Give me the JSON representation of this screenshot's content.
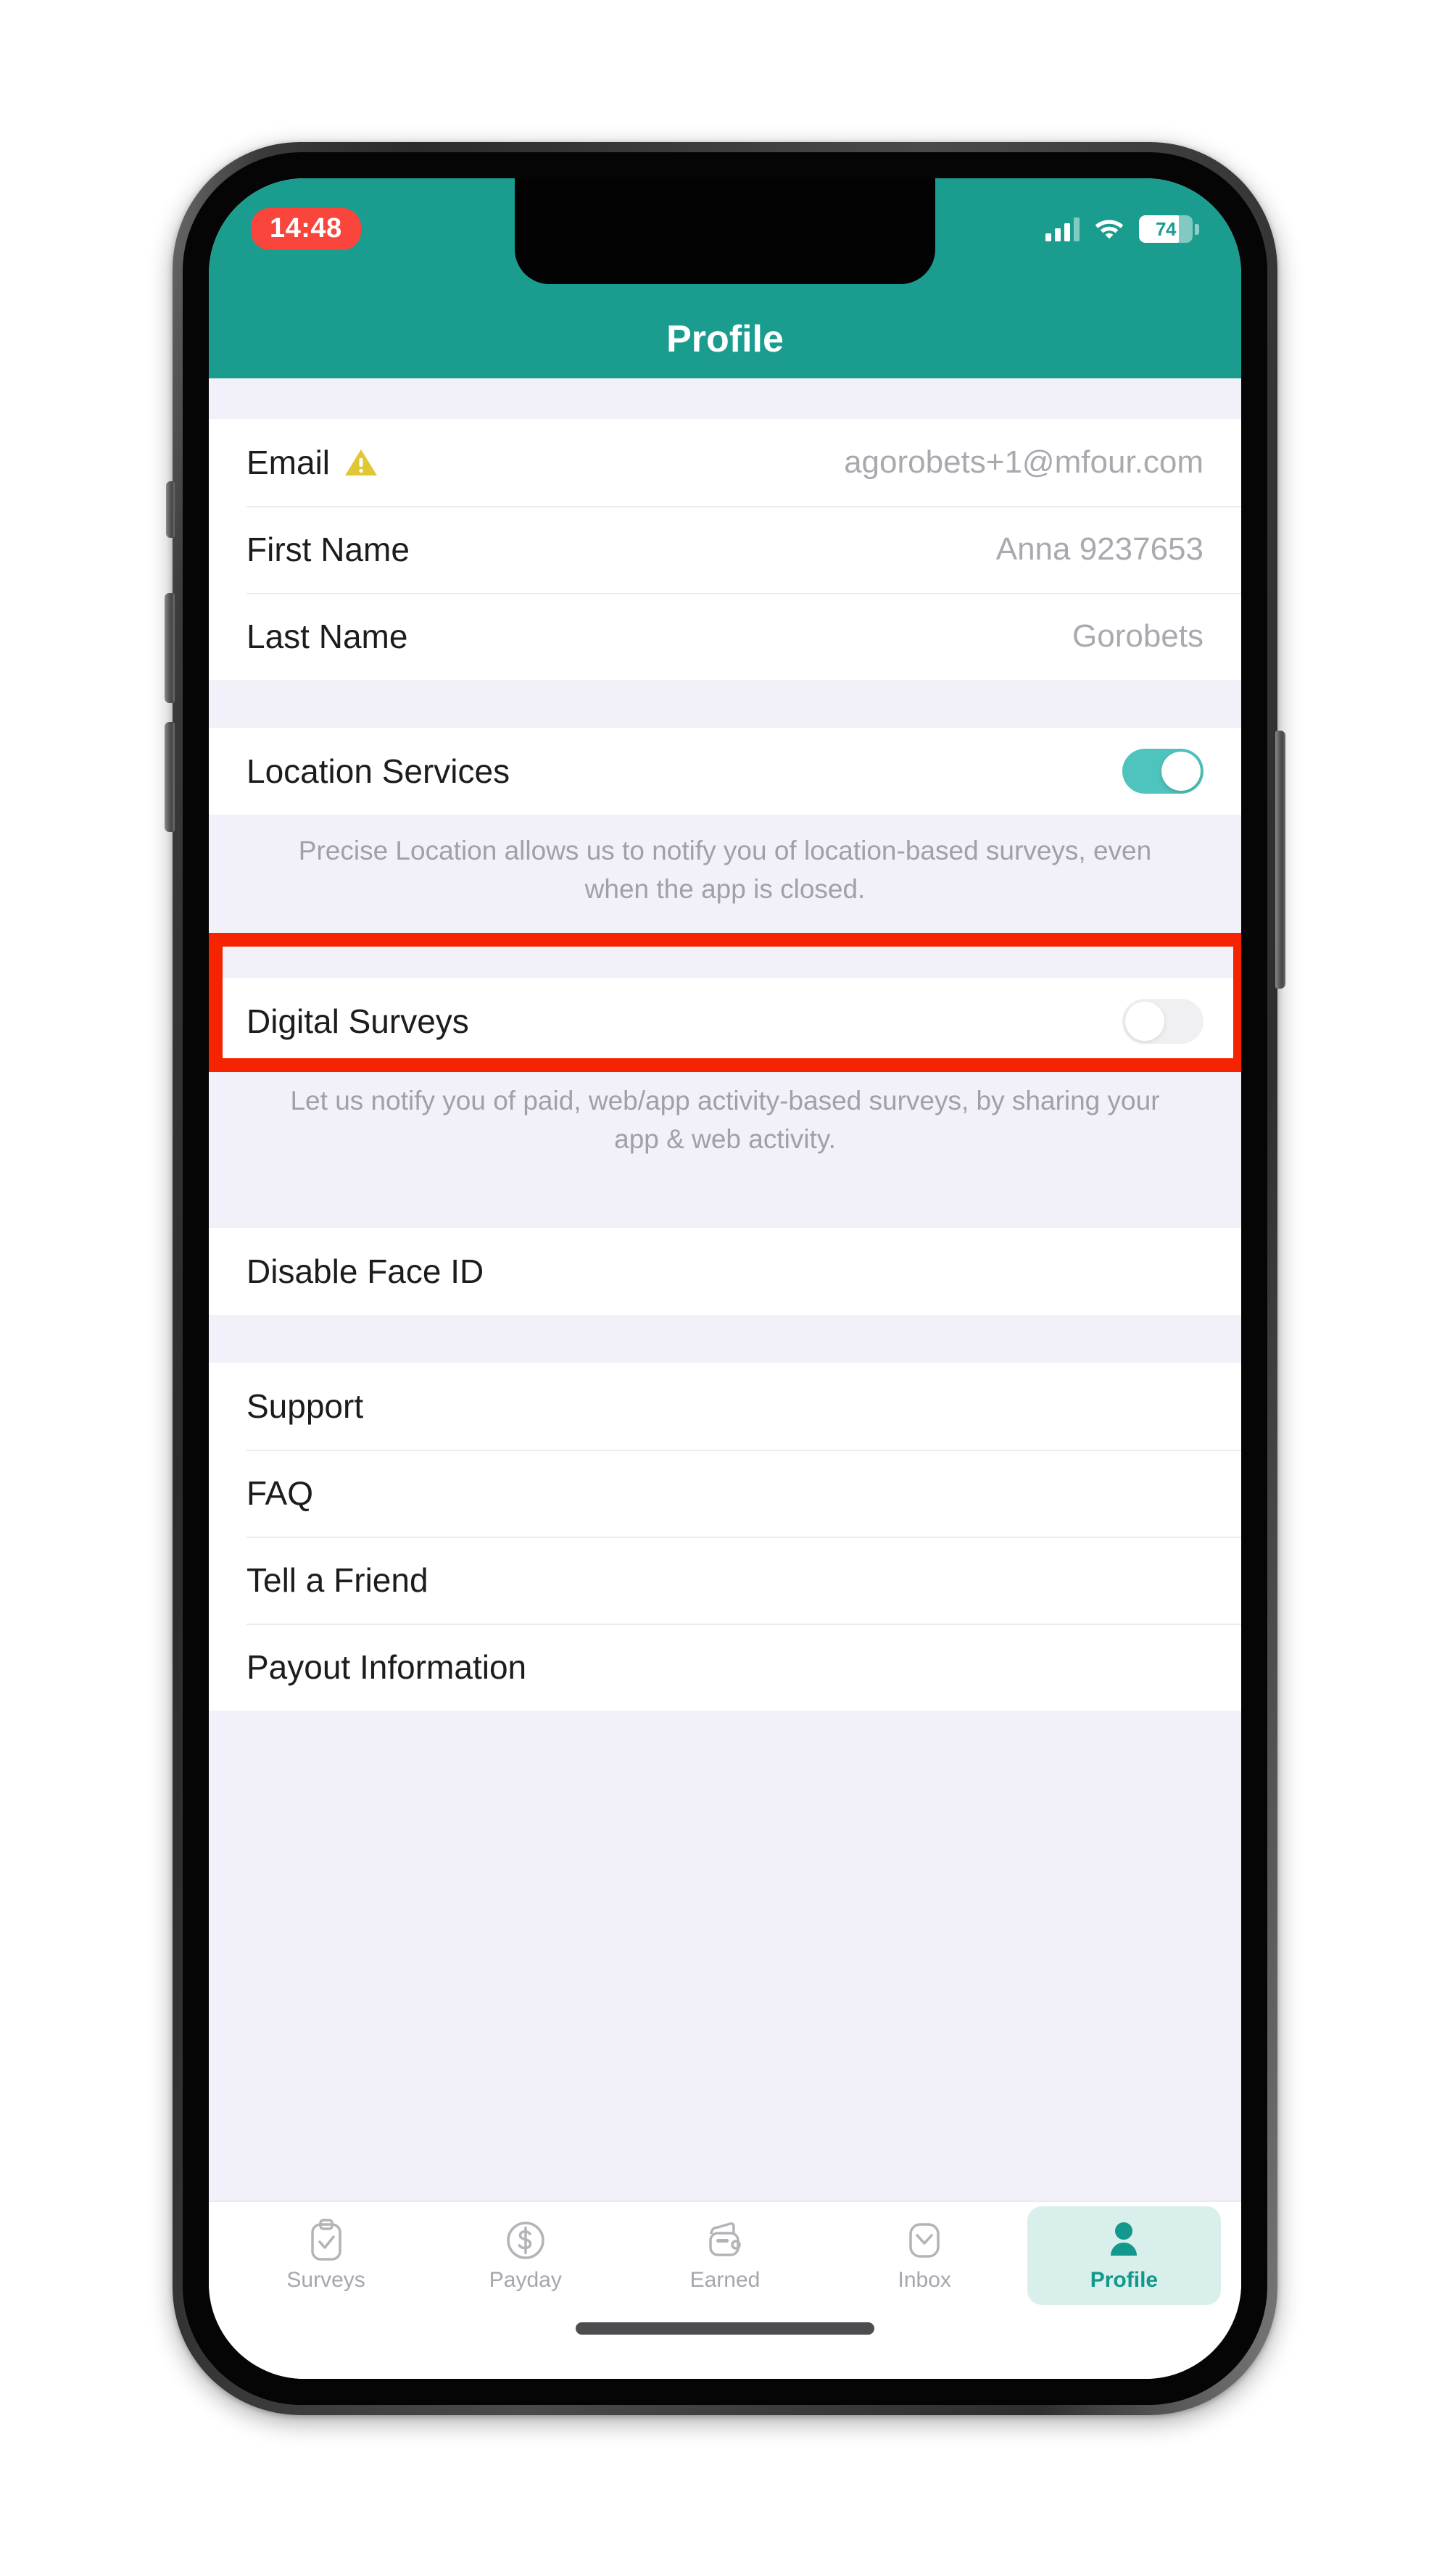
{
  "status_bar": {
    "time": "14:48",
    "battery_percent": "74",
    "signal_icon": "cellular-signal-icon",
    "wifi_icon": "wifi-icon",
    "battery_icon": "battery-icon"
  },
  "header": {
    "title": "Profile",
    "background_color": "#1a9d8f"
  },
  "account_section": {
    "rows": [
      {
        "label": "Email",
        "value": "agorobets+1@mfour.com",
        "has_warning": true,
        "warning_icon": "warning-triangle-icon"
      },
      {
        "label": "First Name",
        "value": "Anna 9237653",
        "has_warning": false
      },
      {
        "label": "Last Name",
        "value": "Gorobets",
        "has_warning": false
      }
    ]
  },
  "location_section": {
    "label": "Location Services",
    "toggle_state": "on",
    "helper_text": "Precise Location allows us to notify you of location-based surveys, even when the app is closed."
  },
  "digital_section": {
    "label": "Digital Surveys",
    "toggle_state": "off",
    "helper_text": "Let us notify you of paid, web/app activity-based surveys, by sharing your app & web activity.",
    "highlighted": true,
    "highlight_color": "#f52300"
  },
  "security_section": {
    "label": "Disable Face ID"
  },
  "menu_section": {
    "items": [
      {
        "label": "Support"
      },
      {
        "label": "FAQ"
      },
      {
        "label": "Tell a Friend"
      },
      {
        "label": "Payout Information"
      }
    ]
  },
  "tab_bar": {
    "tabs": [
      {
        "label": "Surveys",
        "icon": "clipboard-check-icon",
        "active": false
      },
      {
        "label": "Payday",
        "icon": "dollar-circle-icon",
        "active": false
      },
      {
        "label": "Earned",
        "icon": "wallet-icon",
        "active": false
      },
      {
        "label": "Inbox",
        "icon": "envelope-icon",
        "active": false
      },
      {
        "label": "Profile",
        "icon": "person-icon",
        "active": true
      }
    ],
    "active_background": "#d8efeb",
    "active_color": "#12988c"
  },
  "colors": {
    "brand_teal": "#1a9d8f",
    "toggle_on": "#4fc3bd",
    "toggle_off": "#f0f0f2",
    "section_gap": "#f2f0f8",
    "annotation_red": "#f52300",
    "warning_yellow": "#e0c834",
    "clock_red": "#f9453b"
  }
}
